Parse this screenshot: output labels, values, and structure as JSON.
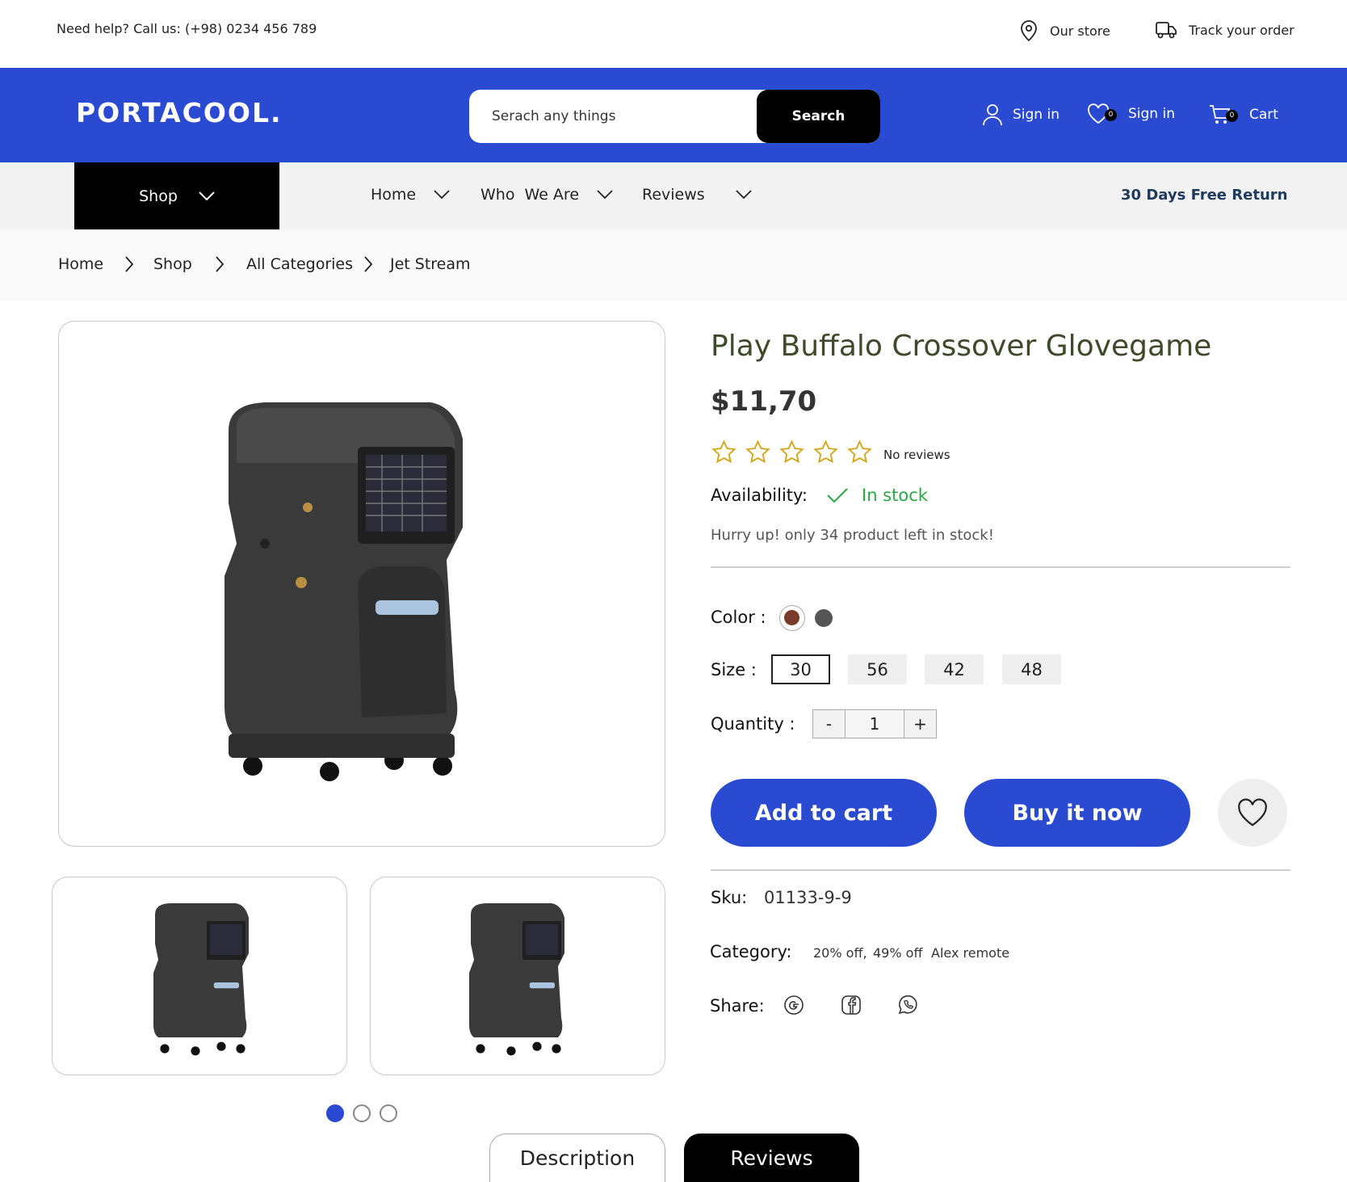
{
  "topbar": {
    "help": "Need help? Call us: (+98) 0234 456 789",
    "store": "Our store",
    "track": "Track your order"
  },
  "header": {
    "logo": "PORTACOOL.",
    "search_placeholder": "Serach any things",
    "search_button": "Search",
    "signin": "Sign in",
    "wishlist_count": "0",
    "wishlist_label": "Sign in",
    "cart_count": "0",
    "cart_label": "Cart"
  },
  "nav": {
    "shop": "Shop",
    "items": [
      "Home",
      "Who  We Are",
      "Reviews"
    ],
    "promo": "30 Days Free Return"
  },
  "breadcrumb": [
    "Home",
    "Shop",
    "All Categories",
    "Jet Stream"
  ],
  "product": {
    "title": "Play Buffalo Crossover Glovegame",
    "price": "$11,70",
    "rating": 0,
    "reviews_text": "No reviews",
    "availability_label": "Availability:",
    "availability_value": "In stock",
    "stock_note": "Hurry up! only 34 product left in stock!",
    "color_label": "Color :",
    "colors": [
      "#7a3b2a",
      "#555555"
    ],
    "size_label": "Size :",
    "sizes": [
      "30",
      "56",
      "42",
      "48"
    ],
    "selected_size": "30",
    "quantity_label": "Quantity :",
    "quantity": "1",
    "minus": "-",
    "plus": "+",
    "add_to_cart": "Add to cart",
    "buy_now": "Buy it now",
    "sku_label": "Sku:",
    "sku": "01133-9-9",
    "category_label": "Category:",
    "categories": [
      "20% off,",
      "49% off",
      "Alex remote"
    ],
    "share_label": "Share:"
  },
  "gallery": {
    "dots": 3,
    "active_dot": 0
  },
  "tabs": [
    "Description",
    "Reviews"
  ],
  "colors": {
    "brand": "#2a4ad2",
    "instock": "#2aa845",
    "star": "#d4a419"
  }
}
